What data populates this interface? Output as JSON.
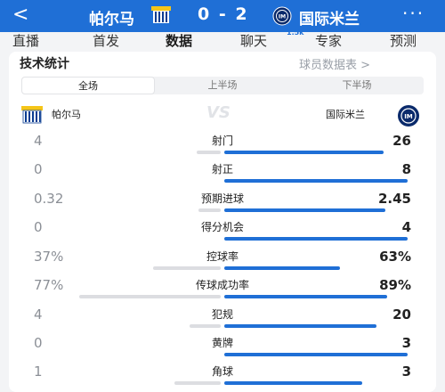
{
  "header": {
    "back_icon": "back-arrow-icon",
    "team_left": "帕尔马",
    "score": "0 - 2",
    "team_right": "国际米兰",
    "more_icon": "more-dots-icon",
    "color": "#1f6fd6"
  },
  "tabs": [
    {
      "label": "直播"
    },
    {
      "label": "首发"
    },
    {
      "label": "数据"
    },
    {
      "label": "聊天"
    },
    {
      "label": "专家"
    },
    {
      "label": "预测"
    }
  ],
  "tab_badge": "1.5k",
  "stats": {
    "title": "技术统计",
    "player_link": "球员数据表 >",
    "segments": [
      "全场",
      "上半场",
      "下半场"
    ],
    "team_left": "帕尔马",
    "team_right": "国际米兰",
    "vs": "VS",
    "rows": [
      {
        "label": "射门",
        "left": "4",
        "right": "26",
        "left_share": 0.13,
        "right_share": 0.87
      },
      {
        "label": "射正",
        "left": "0",
        "right": "8",
        "left_share": 0.0,
        "right_share": 1.0
      },
      {
        "label": "预期进球",
        "left": "0.32",
        "right": "2.45",
        "left_share": 0.12,
        "right_share": 0.88
      },
      {
        "label": "得分机会",
        "left": "0",
        "right": "4",
        "left_share": 0.0,
        "right_share": 1.0
      },
      {
        "label": "控球率",
        "left": "37%",
        "right": "63%",
        "left_share": 0.37,
        "right_share": 0.63
      },
      {
        "label": "传球成功率",
        "left": "77%",
        "right": "89%",
        "left_share": 0.77,
        "right_share": 0.89
      },
      {
        "label": "犯规",
        "left": "4",
        "right": "20",
        "left_share": 0.17,
        "right_share": 0.83
      },
      {
        "label": "黄牌",
        "left": "0",
        "right": "3",
        "left_share": 0.0,
        "right_share": 1.0
      },
      {
        "label": "角球",
        "left": "1",
        "right": "3",
        "left_share": 0.25,
        "right_share": 0.75
      }
    ],
    "bar_colors": {
      "left": "#dcdde1",
      "right": "#1f6fd6"
    }
  }
}
